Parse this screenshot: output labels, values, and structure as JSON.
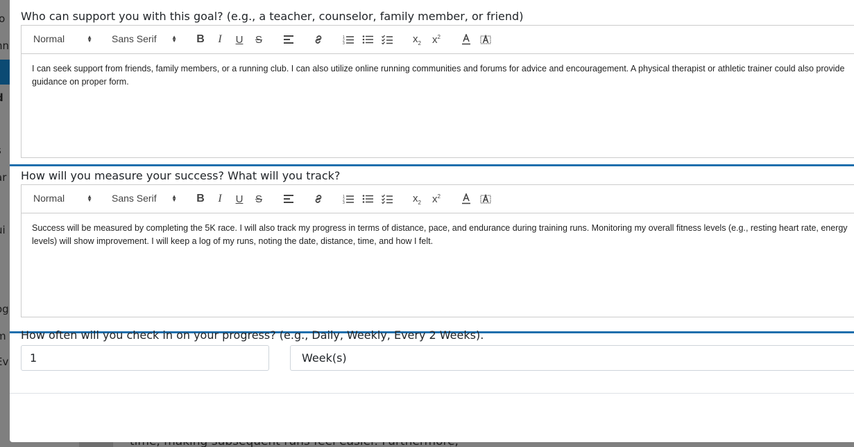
{
  "background": {
    "left_fragments": [
      "lo",
      "nn",
      "d",
      "s",
      "ar",
      "ui",
      "og",
      "m",
      "Ev"
    ],
    "bottom_text": "time, making subsequent runs feel easier. Furthermore,"
  },
  "toolbar": {
    "header_select": "Normal",
    "font_select": "Sans Serif"
  },
  "sections": [
    {
      "question": "Who can support you with this goal? (e.g., a teacher, counselor, family member, or friend)",
      "answer": "I can seek support from friends, family members, or a running club. I can also utilize online running communities and forums for advice and encouragement. A physical therapist or athletic trainer could also provide guidance on proper form."
    },
    {
      "question": "How will you measure your success? What will you track?",
      "answer": "Success will be measured by completing the 5K race. I will also track my progress in terms of distance, pace, and endurance during training runs. Monitoring my overall fitness levels (e.g., resting heart rate, energy levels) will show improvement. I will keep a log of my runs, noting the date, distance, time, and how I felt."
    }
  ],
  "frequency": {
    "question": "How often will you check in on your progress? (e.g., Daily, Weekly, Every 2 Weeks).",
    "number_value": "1",
    "unit_value": "Week(s)"
  },
  "colors": {
    "focus_border": "#1f6fad",
    "background_nav": "#0b4a73"
  }
}
